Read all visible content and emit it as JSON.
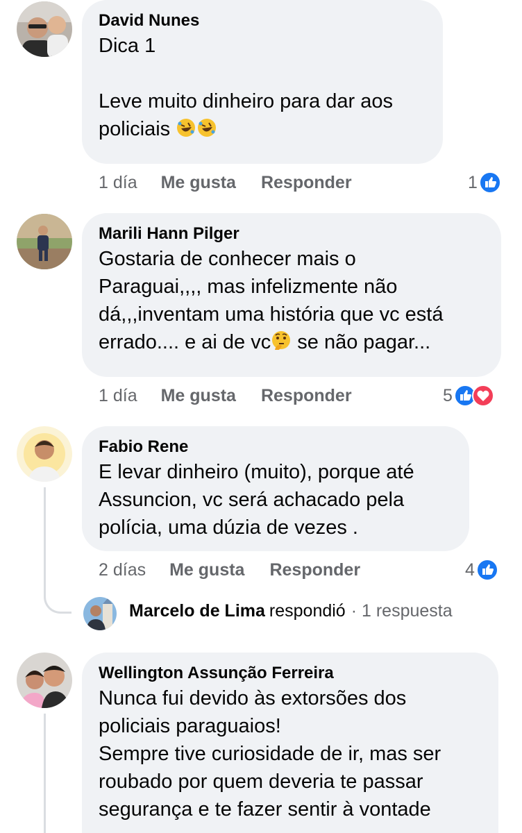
{
  "colors": {
    "like_blue": "#1877f2",
    "love_red": "#f33e58",
    "bubble_bg": "#f0f2f5",
    "secondary_text": "#65676b"
  },
  "icons": {
    "like": "thumbs-up-icon",
    "love": "heart-icon",
    "laugh": "rolling-on-floor-laughing-emoji",
    "thinking": "thinking-face-emoji"
  },
  "comments": [
    {
      "author": "David Nunes",
      "lines": [
        "Dica 1",
        "",
        "Leve muito dinheiro para dar aos",
        "policiais "
      ],
      "time": "1 día",
      "like_label": "Me gusta",
      "reply_label": "Responder",
      "reaction_count": "1"
    },
    {
      "author": "Marili Hann Pilger",
      "lines": [
        "Gostaria de conhecer mais o",
        "Paraguai,,,, mas infelizmente não",
        "dá,,,inventam uma história que vc está",
        "errado.... e ai de vc",
        " se não pagar..."
      ],
      "time": "1 día",
      "like_label": "Me gusta",
      "reply_label": "Responder",
      "reaction_count": "5"
    },
    {
      "author": "Fabio Rene",
      "lines": [
        "E levar dinheiro (muito), porque até",
        "Assuncion, vc será achacado pela",
        "polícia, uma dúzia de vezes ."
      ],
      "time": "2 días",
      "like_label": "Me gusta",
      "reply_label": "Responder",
      "reaction_count": "4",
      "reply_summary": {
        "name": "Marcelo de Lima",
        "text": "respondió",
        "count": "· 1 respuesta"
      }
    },
    {
      "author": "Wellington Assunção Ferreira",
      "lines": [
        "Nunca fui devido às extorsões dos",
        "policiais paraguaios!",
        "Sempre tive curiosidade de ir, mas ser",
        "roubado por quem deveria te passar",
        "segurança e te fazer sentir à vontade"
      ]
    }
  ]
}
